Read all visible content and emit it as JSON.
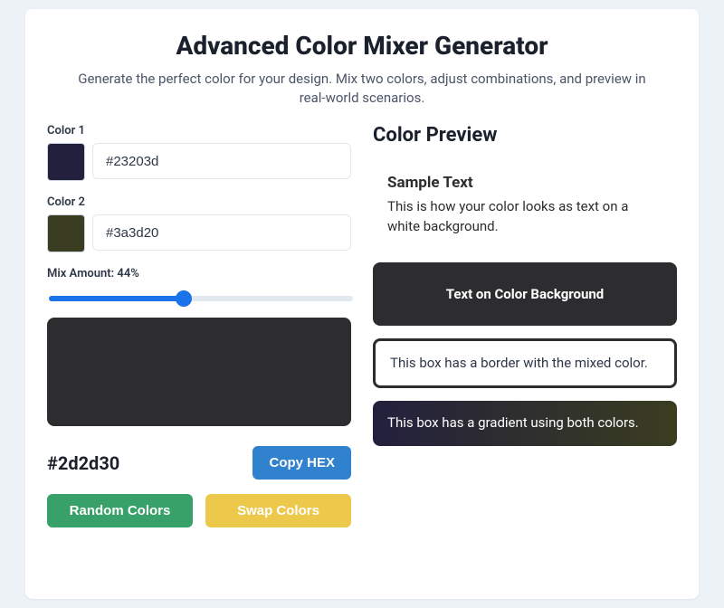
{
  "header": {
    "title": "Advanced Color Mixer Generator",
    "subtitle": "Generate the perfect color for your design. Mix two colors, adjust combinations, and preview in real-world scenarios."
  },
  "colors": {
    "color1": {
      "label": "Color 1",
      "hex": "#23203d"
    },
    "color2": {
      "label": "Color 2",
      "hex": "#3a3d20"
    }
  },
  "mix": {
    "label_prefix": "Mix Amount: ",
    "percent": 44,
    "label_suffix": "%"
  },
  "result": {
    "hex": "#2d2d30",
    "copy_label": "Copy HEX"
  },
  "actions": {
    "random": "Random Colors",
    "swap": "Swap Colors"
  },
  "preview": {
    "heading": "Color Preview",
    "sample_title": "Sample Text",
    "sample_body": "This is how your color looks as text on a white background.",
    "on_color_text": "Text on Color Background",
    "border_text": "This box has a border with the mixed color.",
    "gradient_text": "This box has a gradient using both colors."
  }
}
